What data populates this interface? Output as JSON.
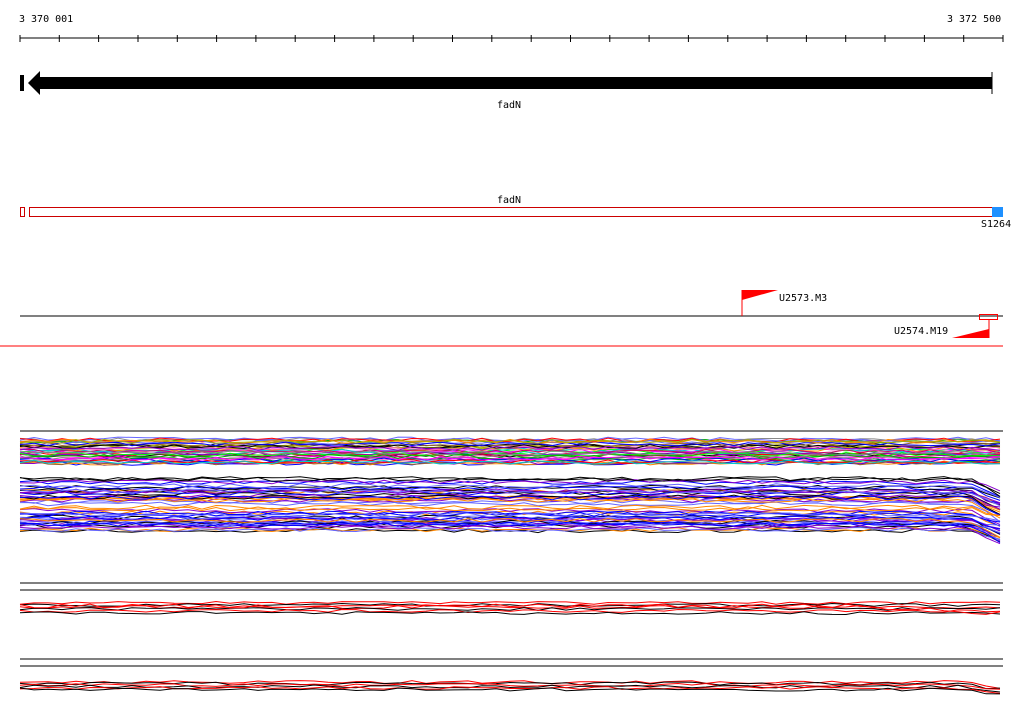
{
  "ruler": {
    "start_label": "3 370 001",
    "end_label": "3 372 500"
  },
  "gene_track": {
    "gene_name": "fadN"
  },
  "transcript_track": {
    "gene_name": "fadN",
    "feature_label": "S1264"
  },
  "features": [
    {
      "label": "U2573.M3"
    },
    {
      "label": "U2574.M19"
    }
  ],
  "colors": {
    "gene_arrow": "#000000",
    "transcript_outline": "#cc0000",
    "feature_marker": "#ff0000",
    "highlight_block": "#1e90ff"
  }
}
